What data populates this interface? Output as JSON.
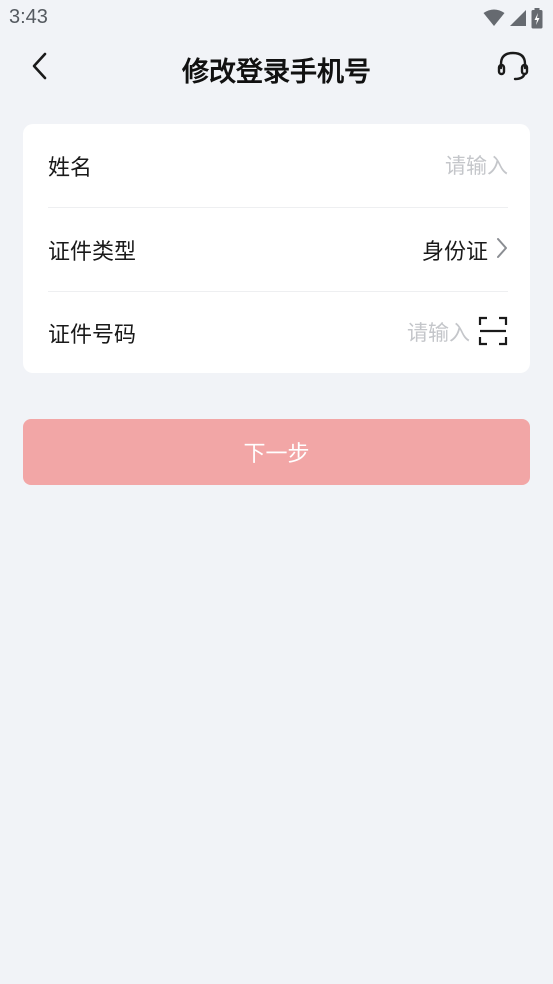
{
  "status_bar": {
    "time": "3:43",
    "icons": [
      "wifi-icon",
      "cellular-signal-icon",
      "battery-charging-icon"
    ]
  },
  "nav": {
    "title": "修改登录手机号",
    "back_icon": "back-chevron-icon",
    "service_icon": "customer-service-headset-icon"
  },
  "form": {
    "name": {
      "label": "姓名",
      "placeholder": "请输入",
      "value": ""
    },
    "id_type": {
      "label": "证件类型",
      "value": "身份证",
      "icon": "chevron-right-icon"
    },
    "id_number": {
      "label": "证件号码",
      "placeholder": "请输入",
      "value": "",
      "icon": "scan-icon"
    }
  },
  "next_button": {
    "label": "下一步",
    "enabled": false
  },
  "colors": {
    "background": "#f1f3f7",
    "card": "#ffffff",
    "button_disabled": "#f2a6a6",
    "placeholder": "#c4c6ca"
  }
}
